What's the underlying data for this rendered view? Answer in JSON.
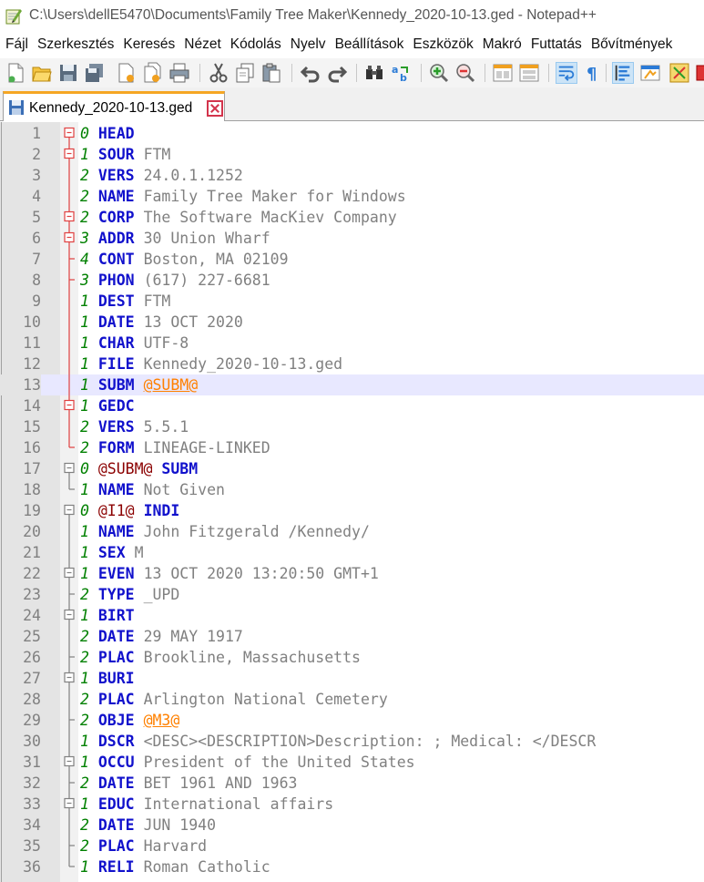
{
  "window": {
    "title": "C:\\Users\\dellE5470\\Documents\\Family Tree Maker\\Kennedy_2020-10-13.ged - Notepad++",
    "icon": "notepad-plus-plus-icon"
  },
  "menu": [
    "Fájl",
    "Szerkesztés",
    "Keresés",
    "Nézet",
    "Kódolás",
    "Nyelv",
    "Beállítások",
    "Eszközök",
    "Makró",
    "Futtatás",
    "Bővítmények"
  ],
  "toolbar": [
    {
      "name": "new-file-icon"
    },
    {
      "name": "open-file-icon"
    },
    {
      "name": "save-icon"
    },
    {
      "name": "save-all-icon"
    },
    {
      "name": "close-icon"
    },
    {
      "name": "close-all-icon"
    },
    {
      "name": "print-icon"
    },
    {
      "name": "cut-icon"
    },
    {
      "name": "copy-icon"
    },
    {
      "name": "paste-icon"
    },
    {
      "name": "undo-icon"
    },
    {
      "name": "redo-icon"
    },
    {
      "name": "find-icon"
    },
    {
      "name": "replace-icon"
    },
    {
      "name": "zoom-in-icon"
    },
    {
      "name": "zoom-out-icon"
    },
    {
      "name": "sync-vertical-icon"
    },
    {
      "name": "sync-horizontal-icon"
    },
    {
      "name": "word-wrap-icon"
    },
    {
      "name": "show-all-characters-icon"
    },
    {
      "name": "indent-guide-icon"
    },
    {
      "name": "document-map-icon"
    },
    {
      "name": "function-list-icon"
    },
    {
      "name": "folder-workspace-icon"
    }
  ],
  "tab": {
    "label": "Kennedy_2020-10-13.ged",
    "icon": "save-icon"
  },
  "editor": {
    "current_line": 13,
    "lines": [
      {
        "n": "1",
        "lvl": "0",
        "a": "HEAD",
        "b": ""
      },
      {
        "n": "2",
        "lvl": "1",
        "a": "SOUR",
        "b": "FTM"
      },
      {
        "n": "3",
        "lvl": "2",
        "a": "VERS",
        "b": "24.0.1.1252"
      },
      {
        "n": "4",
        "lvl": "2",
        "a": "NAME",
        "b": "Family Tree Maker for Windows"
      },
      {
        "n": "5",
        "lvl": "2",
        "a": "CORP",
        "b": "The Software MacKiev Company"
      },
      {
        "n": "6",
        "lvl": "3",
        "a": "ADDR",
        "b": "30 Union Wharf"
      },
      {
        "n": "7",
        "lvl": "4",
        "a": "CONT",
        "b": "Boston, MA 02109"
      },
      {
        "n": "8",
        "lvl": "3",
        "a": "PHON",
        "b": "(617) 227-6681"
      },
      {
        "n": "9",
        "lvl": "1",
        "a": "DEST",
        "b": "FTM"
      },
      {
        "n": "10",
        "lvl": "1",
        "a": "DATE",
        "b": "13 OCT 2020"
      },
      {
        "n": "11",
        "lvl": "1",
        "a": "CHAR",
        "b": "UTF-8"
      },
      {
        "n": "12",
        "lvl": "1",
        "a": "FILE",
        "b": "Kennedy_2020-10-13.ged"
      },
      {
        "n": "13",
        "lvl": "1",
        "a": "SUBM",
        "b": "@SUBM@"
      },
      {
        "n": "14",
        "lvl": "1",
        "a": "GEDC",
        "b": ""
      },
      {
        "n": "15",
        "lvl": "2",
        "a": "VERS",
        "b": "5.5.1"
      },
      {
        "n": "16",
        "lvl": "2",
        "a": "FORM",
        "b": "LINEAGE-LINKED"
      },
      {
        "n": "17",
        "lvl": "0",
        "a": "@SUBM@",
        "b": "SUBM"
      },
      {
        "n": "18",
        "lvl": "1",
        "a": "NAME",
        "b": "Not Given"
      },
      {
        "n": "19",
        "lvl": "0",
        "a": "@I1@",
        "b": "INDI"
      },
      {
        "n": "20",
        "lvl": "1",
        "a": "NAME",
        "b": "John Fitzgerald /Kennedy/"
      },
      {
        "n": "21",
        "lvl": "1",
        "a": "SEX",
        "b": "M"
      },
      {
        "n": "22",
        "lvl": "1",
        "a": "EVEN",
        "b": "13 OCT 2020 13:20:50 GMT+1"
      },
      {
        "n": "23",
        "lvl": "2",
        "a": "TYPE",
        "b": "_UPD"
      },
      {
        "n": "24",
        "lvl": "1",
        "a": "BIRT",
        "b": ""
      },
      {
        "n": "25",
        "lvl": "2",
        "a": "DATE",
        "b": "29 MAY 1917"
      },
      {
        "n": "26",
        "lvl": "2",
        "a": "PLAC",
        "b": "Brookline, Massachusetts"
      },
      {
        "n": "27",
        "lvl": "1",
        "a": "BURI",
        "b": ""
      },
      {
        "n": "28",
        "lvl": "2",
        "a": "PLAC",
        "b": "Arlington National Cemetery"
      },
      {
        "n": "29",
        "lvl": "2",
        "a": "OBJE",
        "b": "@M3@"
      },
      {
        "n": "30",
        "lvl": "1",
        "a": "DSCR",
        "b": "<DESC><DESCRIPTION>Description: ; Medical: </DESCR"
      },
      {
        "n": "31",
        "lvl": "1",
        "a": "OCCU",
        "b": "President of the United States"
      },
      {
        "n": "32",
        "lvl": "2",
        "a": "DATE",
        "b": "BET 1961 AND 1963"
      },
      {
        "n": "33",
        "lvl": "1",
        "a": "EDUC",
        "b": "International affairs"
      },
      {
        "n": "34",
        "lvl": "2",
        "a": "DATE",
        "b": "JUN 1940"
      },
      {
        "n": "35",
        "lvl": "2",
        "a": "PLAC",
        "b": "Harvard"
      },
      {
        "n": "36",
        "lvl": "1",
        "a": "RELI",
        "b": "Roman Catholic"
      }
    ]
  }
}
